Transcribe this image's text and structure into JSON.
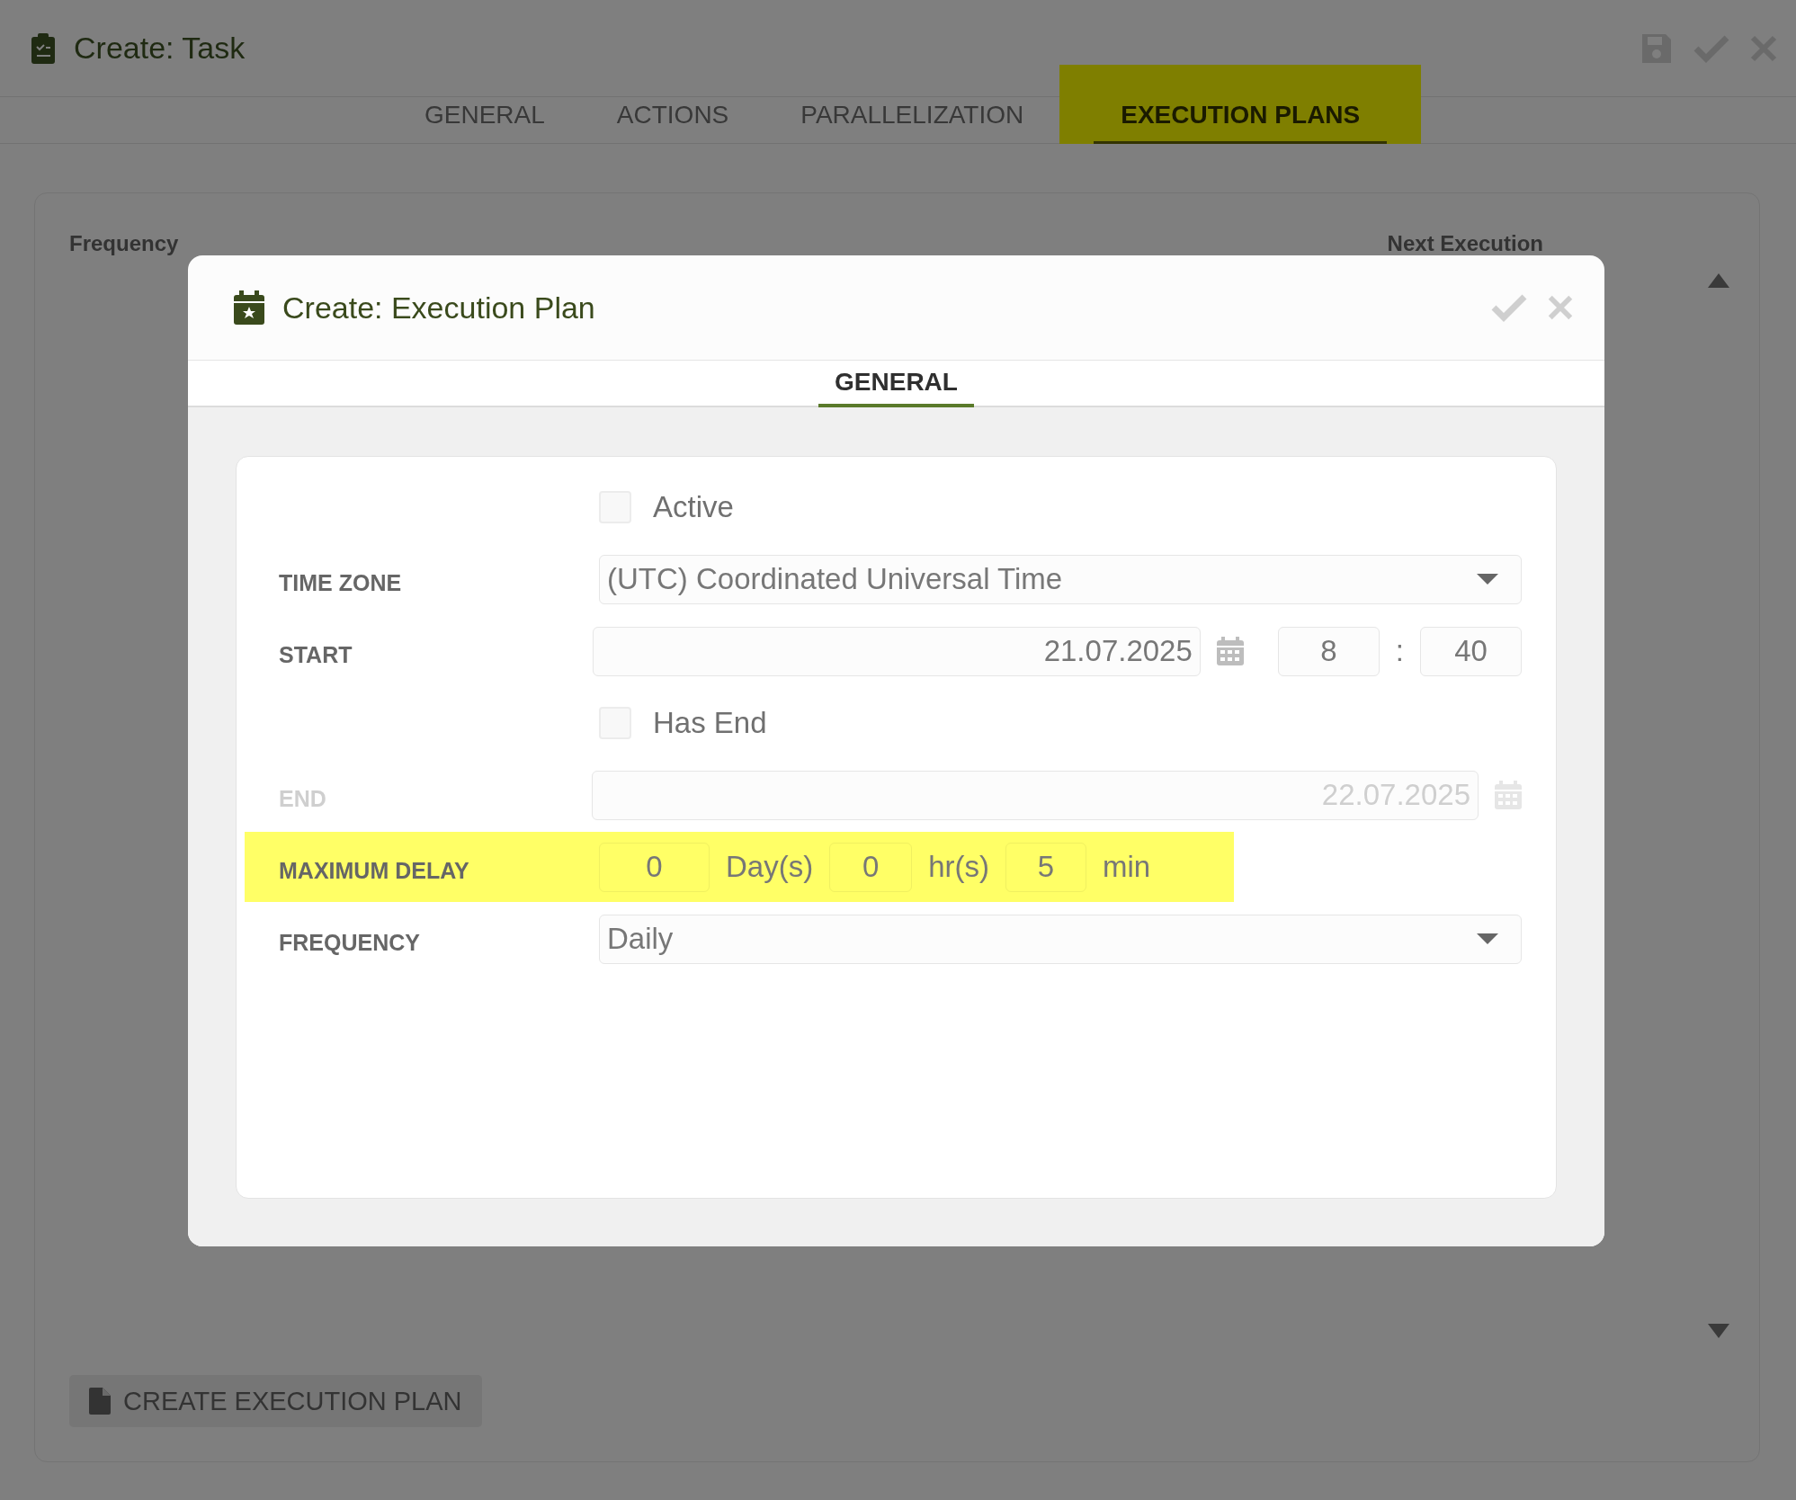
{
  "page": {
    "title": "Create: Task",
    "tabs": [
      {
        "label": "GENERAL",
        "selected": false,
        "highlighted": false
      },
      {
        "label": "ACTIONS",
        "selected": false,
        "highlighted": false
      },
      {
        "label": "PARALLELIZATION",
        "selected": false,
        "highlighted": false
      },
      {
        "label": "EXECUTION PLANS",
        "selected": true,
        "highlighted": true
      }
    ],
    "list": {
      "columns": [
        "Frequency",
        "Next Execution"
      ]
    },
    "create_button": "CREATE EXECUTION PLAN"
  },
  "dialog": {
    "title": "Create: Execution Plan",
    "tabs": [
      {
        "label": "GENERAL",
        "selected": true
      }
    ],
    "fields": [
      {
        "kind": "checkbox",
        "label": "Active",
        "checked": false,
        "disabled": false,
        "highlighted": false
      },
      {
        "kind": "select",
        "label": "TIME ZONE",
        "value": "(UTC) Coordinated Universal Time",
        "disabled": false,
        "highlighted": false
      },
      {
        "kind": "datetime",
        "label": "START",
        "date": "21.07.2025",
        "hour": "8",
        "separator": ":",
        "minute": "40",
        "disabled": false,
        "highlighted": false
      },
      {
        "kind": "checkbox",
        "label": "Has End",
        "checked": false,
        "disabled": false,
        "highlighted": false
      },
      {
        "kind": "date",
        "label": "END",
        "date": "22.07.2025",
        "disabled": true,
        "highlighted": false
      },
      {
        "kind": "duration",
        "label": "MAXIMUM DELAY",
        "disabled": false,
        "highlighted": true,
        "parts": [
          {
            "value": "0",
            "unit": "Day(s)"
          },
          {
            "value": "0",
            "unit": "hr(s)"
          },
          {
            "value": "5",
            "unit": "min"
          }
        ]
      },
      {
        "kind": "select",
        "label": "FREQUENCY",
        "value": "Daily",
        "disabled": false,
        "highlighted": false
      }
    ]
  }
}
